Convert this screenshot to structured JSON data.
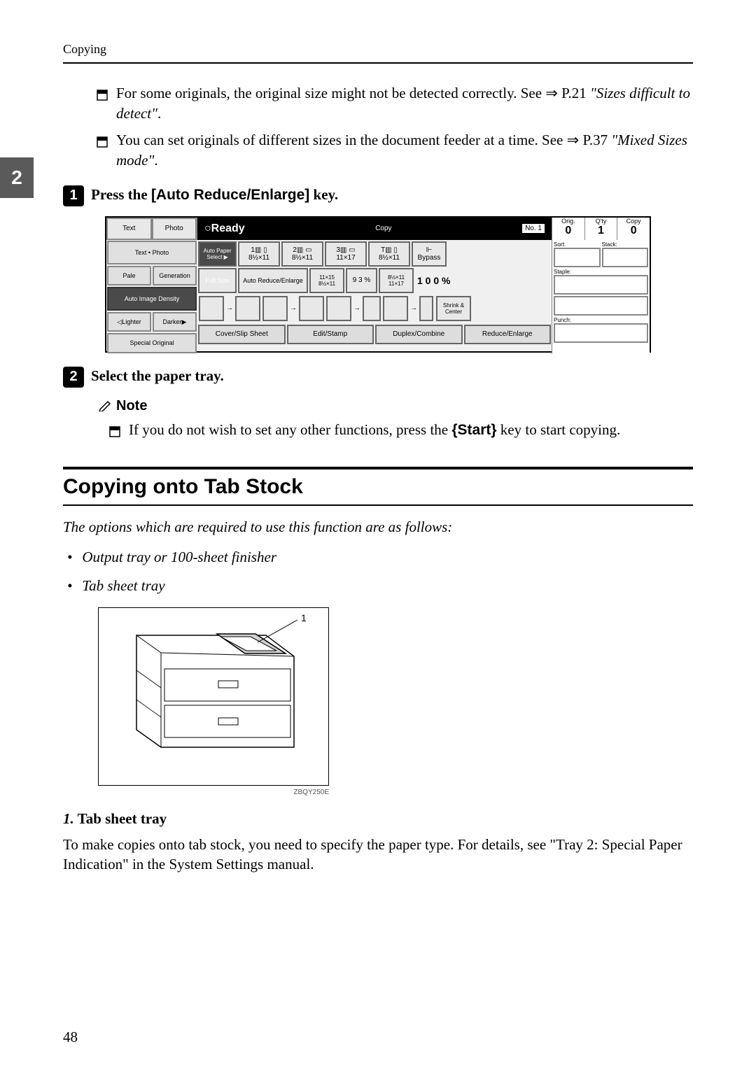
{
  "header": "Copying",
  "sideTab": "2",
  "bullets": [
    {
      "text_a": "For some originals, the original size might not be detected correctly. See ⇒ P.21 ",
      "text_b": "\"Sizes difficult to detect\"",
      "text_c": "."
    },
    {
      "text_a": "You can set originals of different sizes in the document feeder at a time. See ⇒ P.37 ",
      "text_b": "\"Mixed Sizes mode\"",
      "text_c": "."
    }
  ],
  "step1": {
    "num": "1",
    "text_a": "Press the ",
    "key": "[Auto Reduce/Enlarge]",
    "text_b": " key."
  },
  "panel": {
    "ready": "○Ready",
    "topLabels": {
      "copy": "Copy",
      "no": "No. 1",
      "orig": "Orig.",
      "qty": "Q'ty",
      "cpy": "Copy",
      "orig_v": "0",
      "qty_v": "1",
      "cpy_v": "0"
    },
    "leftTabs": {
      "text": "Text",
      "photo": "Photo",
      "textphoto": "Text • Photo",
      "pale": "Pale",
      "generation": "Generation",
      "autoimg": "Auto Image Density",
      "lighter": "◁Lighter",
      "darker": "Darker▶",
      "special": "Special Original"
    },
    "paper": {
      "auto": "Auto Paper Select ▶",
      "p1": "8½×11",
      "p2": "8½×11",
      "p3": "11×17",
      "p4": "8½×11",
      "bypass": "Bypass"
    },
    "ratio": {
      "full": "Full Size",
      "autore": "Auto Reduce/Enlarge",
      "r1": "11×15 8½×11",
      "r2": "9 3 %",
      "r3": "8½×11 11×17",
      "pct": "1 0 0 %",
      "shrink": "Shrink & Center"
    },
    "bottomTabs": {
      "t1": "Cover/Slip Sheet",
      "t2": "Edit/Stamp",
      "t3": "Duplex/Combine",
      "t4": "Reduce/Enlarge"
    },
    "rightLabels": {
      "sort": "Sort:",
      "stack": "Stack:",
      "staple": "Staple:",
      "punch": "Punch:"
    }
  },
  "step2": {
    "num": "2",
    "text": "Select the paper tray."
  },
  "note": {
    "heading": "Note",
    "body_a": "If you do not wish to set any other functions, press the ",
    "key": "{Start}",
    "body_b": " key to start copying."
  },
  "section": {
    "heading": "Copying onto Tab Stock",
    "intro": "The options which are required to use this function are as follows:",
    "options": [
      "Output tray or 100-sheet finisher",
      "Tab sheet tray"
    ]
  },
  "diagram": {
    "callout": "1",
    "caption": "ZBQY250E"
  },
  "subsection": {
    "num": "1.",
    "label": " Tab sheet tray",
    "body": "To make copies onto tab stock, you need to specify the paper type. For details, see \"Tray 2: Special Paper Indication\" in the System Settings manual."
  },
  "pageNum": "48"
}
